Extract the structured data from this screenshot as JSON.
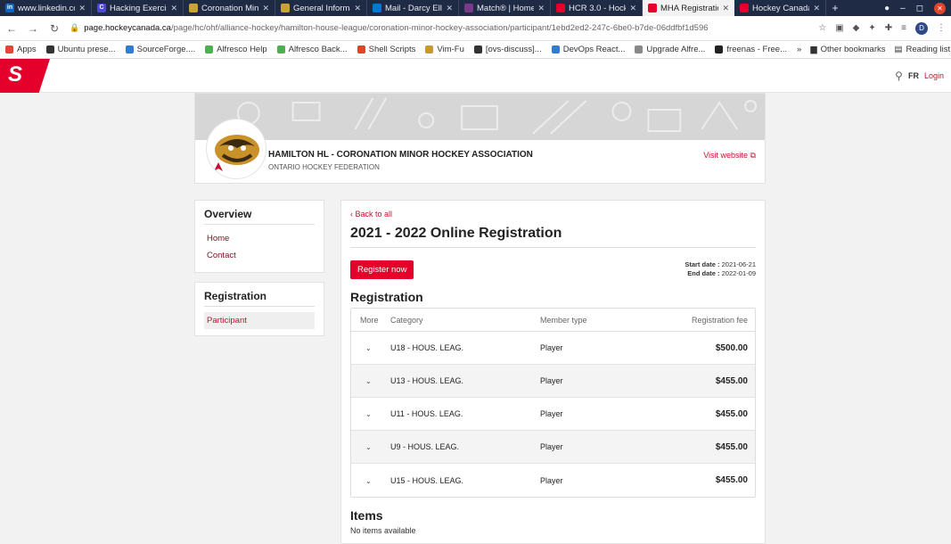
{
  "browser": {
    "tabs": [
      {
        "title": "www.linkedin.co",
        "color": "#0a66c2",
        "glyph": "in"
      },
      {
        "title": "Hacking Exercise",
        "color": "#4a4ad6",
        "glyph": "C"
      },
      {
        "title": "Coronation Mino",
        "color": "#caa23a",
        "glyph": ""
      },
      {
        "title": "General Informa",
        "color": "#caa23a",
        "glyph": ""
      },
      {
        "title": "Mail - Darcy Ellio",
        "color": "#0078d4",
        "glyph": ""
      },
      {
        "title": "Match® | Home",
        "color": "#7a3a8a",
        "glyph": ""
      },
      {
        "title": "HCR 3.0 - Hockey",
        "color": "#e4002b",
        "glyph": ""
      },
      {
        "title": "MHA Registratio",
        "color": "#e4002b",
        "glyph": "",
        "active": true
      },
      {
        "title": "Hockey Canada",
        "color": "#e4002b",
        "glyph": ""
      }
    ],
    "url_host": "page.hockeycanada.ca",
    "url_path": "/page/hc/ohf/alliance-hockey/hamilton-house-league/coronation-minor-hockey-association/participant/1ebd2ed2-247c-6be0-b7de-06ddfbf1d596",
    "bookmarks": [
      {
        "label": "Apps",
        "color": "#e94335"
      },
      {
        "label": "Ubuntu prese...",
        "color": "#333"
      },
      {
        "label": "SourceForge....",
        "color": "#2e7dd1"
      },
      {
        "label": "Alfresco Help",
        "color": "#4caf50"
      },
      {
        "label": "Alfresco Back...",
        "color": "#4caf50"
      },
      {
        "label": "Shell Scripts",
        "color": "#e0452a"
      },
      {
        "label": "Vim-Fu",
        "color": "#c89a2a"
      },
      {
        "label": "[ovs-discuss]...",
        "color": "#333"
      },
      {
        "label": "DevOps React...",
        "color": "#2e7dd1"
      },
      {
        "label": "Upgrade Alfre...",
        "color": "#888"
      },
      {
        "label": "freenas - Free...",
        "color": "#222"
      }
    ],
    "bookmarks_more": "»",
    "other_bookmarks": "Other bookmarks",
    "reading_list": "Reading list"
  },
  "header": {
    "logo_text": "S",
    "lang": "FR",
    "login": "Login"
  },
  "org": {
    "name": "HAMILTON HL - CORONATION MINOR HOCKEY ASSOCIATION",
    "federation": "ONTARIO HOCKEY FEDERATION",
    "visit": "Visit website ⧉"
  },
  "sidebar": {
    "overview_title": "Overview",
    "overview_items": [
      "Home",
      "Contact"
    ],
    "registration_title": "Registration",
    "registration_items": [
      "Participant"
    ]
  },
  "main": {
    "back": "‹  Back to all",
    "title": "2021 - 2022 Online Registration",
    "register_btn": "Register now",
    "start_label": "Start date :",
    "start_date": "2021-06-21",
    "end_label": "End date :",
    "end_date": "2022-01-09",
    "registration_title": "Registration",
    "columns": {
      "more": "More",
      "category": "Category",
      "member_type": "Member type",
      "fee": "Registration fee"
    },
    "rows": [
      {
        "category": "U18 - HOUS. LEAG.",
        "member_type": "Player",
        "fee": "$500.00"
      },
      {
        "category": "U13 - HOUS. LEAG.",
        "member_type": "Player",
        "fee": "$455.00"
      },
      {
        "category": "U11 - HOUS. LEAG.",
        "member_type": "Player",
        "fee": "$455.00"
      },
      {
        "category": "U9 - HOUS. LEAG.",
        "member_type": "Player",
        "fee": "$455.00"
      },
      {
        "category": "U15 - HOUS. LEAG.",
        "member_type": "Player",
        "fee": "$455.00"
      }
    ],
    "items_title": "Items",
    "no_items": "No items available"
  },
  "colors": {
    "brand_red": "#e4002b",
    "link_red": "#c8102e",
    "tabbar": "#1f2a45"
  }
}
